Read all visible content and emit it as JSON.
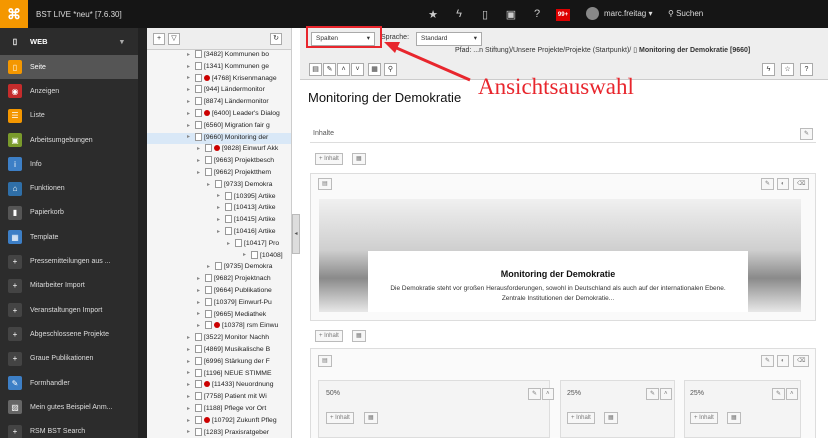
{
  "topbar": {
    "site_title": "BST LIVE *neu* [7.6.30]",
    "badge": "99+",
    "user": "marc.freitag",
    "search": "Suchen"
  },
  "modules": [
    {
      "type": "group",
      "label": "WEB",
      "icon": "page-icon",
      "color": "#2c2c2c"
    },
    {
      "type": "item",
      "label": "Seite",
      "icon": "page-icon",
      "color": "#f49700",
      "active": true
    },
    {
      "type": "item",
      "label": "Anzeigen",
      "icon": "eye-icon",
      "color": "#c52c2c"
    },
    {
      "type": "item",
      "label": "Liste",
      "icon": "list-icon",
      "color": "#f49700"
    },
    {
      "type": "item",
      "label": "Arbeitsumgebungen",
      "icon": "workspaces-icon",
      "color": "#7a9b2c"
    },
    {
      "type": "item",
      "label": "Info",
      "icon": "info-icon",
      "color": "#3d7fc6"
    },
    {
      "type": "item",
      "label": "Funktionen",
      "icon": "functions-icon",
      "color": "#2f6fa8"
    },
    {
      "type": "item",
      "label": "Papierkorb",
      "icon": "trash-icon",
      "color": "#555"
    },
    {
      "type": "item",
      "label": "Template",
      "icon": "template-icon",
      "color": "#3d7fc6"
    },
    {
      "type": "item",
      "label": "Pressemitteilungen aus ...",
      "icon": "module-icon",
      "color": "#444"
    },
    {
      "type": "item",
      "label": "Mitarbeiter Import",
      "icon": "module-icon",
      "color": "#444"
    },
    {
      "type": "item",
      "label": "Veranstaltungen Import",
      "icon": "module-icon",
      "color": "#444"
    },
    {
      "type": "item",
      "label": "Abgeschlossene Projekte",
      "icon": "module-icon",
      "color": "#444"
    },
    {
      "type": "item",
      "label": "Graue Publikationen",
      "icon": "module-icon",
      "color": "#444"
    },
    {
      "type": "item",
      "label": "Formhandler",
      "icon": "form-icon",
      "color": "#3d7fc6"
    },
    {
      "type": "item",
      "label": "Mein gutes Beispiel Anm...",
      "icon": "image-icon",
      "color": "#666"
    },
    {
      "type": "item",
      "label": "RSM BST Search",
      "icon": "module-icon",
      "color": "#444"
    }
  ],
  "tree": [
    {
      "label": "[3482] Kommunen bo",
      "indent": 40,
      "red": false
    },
    {
      "label": "[1341] Kommunen ge",
      "indent": 40,
      "red": false
    },
    {
      "label": "[4768] Krisenmanage",
      "indent": 40,
      "red": true
    },
    {
      "label": "[944] Ländermonitor",
      "indent": 40,
      "red": false
    },
    {
      "label": "[8874] Ländermonitor",
      "indent": 40,
      "red": false
    },
    {
      "label": "[6400] Leader's Dialog",
      "indent": 40,
      "red": true
    },
    {
      "label": "[6560] Migration fair g",
      "indent": 40,
      "red": false
    },
    {
      "label": "[9660] Monitoring der",
      "indent": 40,
      "red": false,
      "sel": true
    },
    {
      "label": "[9828] Einwurf Akk",
      "indent": 50,
      "red": true
    },
    {
      "label": "[9663] Projektbesch",
      "indent": 50,
      "red": false
    },
    {
      "label": "[9662] Projektthem",
      "indent": 50,
      "red": false
    },
    {
      "label": "[9733] Demokra",
      "indent": 60,
      "red": false
    },
    {
      "label": "[10395] Artike",
      "indent": 70,
      "red": false
    },
    {
      "label": "[10413] Artike",
      "indent": 70,
      "red": false
    },
    {
      "label": "[10415] Artike",
      "indent": 70,
      "red": false
    },
    {
      "label": "[10416] Artike",
      "indent": 70,
      "red": false
    },
    {
      "label": "[10417] Pro",
      "indent": 80,
      "red": false
    },
    {
      "label": "[10408]",
      "indent": 96,
      "red": false
    },
    {
      "label": "[9735] Demokra",
      "indent": 60,
      "red": false
    },
    {
      "label": "[9682] Projektnach",
      "indent": 50,
      "red": false
    },
    {
      "label": "[9664] Publikatione",
      "indent": 50,
      "red": false
    },
    {
      "label": "[10379] Einwurf-Pu",
      "indent": 50,
      "red": false
    },
    {
      "label": "[9665] Mediathek",
      "indent": 50,
      "red": false
    },
    {
      "label": "[10378] rsm Einwu",
      "indent": 50,
      "red": true
    },
    {
      "label": "[3522] Monitor Nachh",
      "indent": 40,
      "red": false
    },
    {
      "label": "[4869] Musikalische B",
      "indent": 40,
      "red": false
    },
    {
      "label": "[6996] Stärkung der F",
      "indent": 40,
      "red": false
    },
    {
      "label": "[1196] NEUE STIMME",
      "indent": 40,
      "red": false
    },
    {
      "label": "[11433] Neuordnung",
      "indent": 40,
      "red": true
    },
    {
      "label": "[7758] Patient mit Wi",
      "indent": 40,
      "red": false
    },
    {
      "label": "[1188] Pflege vor Ort",
      "indent": 40,
      "red": false
    },
    {
      "label": "[10792] Zukunft Pfleg",
      "indent": 40,
      "red": true
    },
    {
      "label": "[1283] Praxisratgeber",
      "indent": 40,
      "red": false
    }
  ],
  "doc": {
    "view_select": "Spalten",
    "lang_label": "Sprache:",
    "lang_select": "Standard",
    "path_prefix": "Pfad: ...n Stiftung)/Unsere Projekte/Projekte (Startpunkt)/",
    "path_current": "Monitoring der Demokratie [9660]",
    "annotation": "Ansichtsauswahl",
    "title": "Monitoring der Demokratie",
    "inhalte": "Inhalte",
    "inhalt_btn": "Inhalt",
    "hero_title": "Monitoring der Demokratie",
    "hero_text": "Die Demokratie steht vor großen Herausforderungen, sowohl in Deutschland als auch auf der internationalen Ebene. Zentrale Institutionen der Demokratie...",
    "col1": "50%",
    "col2": "25%",
    "col3": "25%"
  }
}
